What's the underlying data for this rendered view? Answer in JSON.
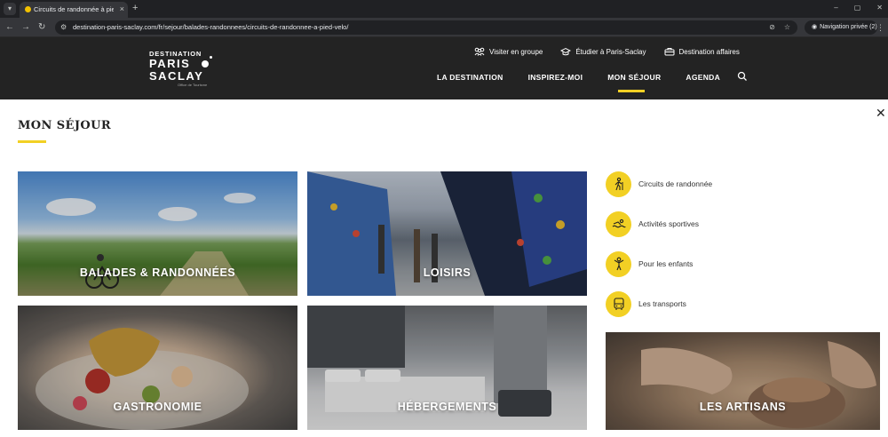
{
  "browser": {
    "tab_title": "Circuits de randonnée à pied et",
    "tab_close": "×",
    "new_tab": "+",
    "url": "destination-paris-saclay.com/fr/sejour/balades-randonnees/circuits-de-randonnee-a-pied-velo/",
    "private_label": "Navigation privée (2)",
    "window_controls": [
      "–",
      "▢",
      "✕"
    ]
  },
  "header": {
    "logo": {
      "line1": "DESTINATION",
      "line2": "PARIS",
      "line3": "SACLAY",
      "tagline": "Office de Tourisme"
    },
    "util_links": [
      {
        "label": "Visiter en groupe",
        "icon": "group-icon"
      },
      {
        "label": "Étudier à Paris-Saclay",
        "icon": "graduation-cap-icon"
      },
      {
        "label": "Destination affaires",
        "icon": "briefcase-icon"
      }
    ],
    "nav": [
      {
        "label": "LA DESTINATION",
        "active": false
      },
      {
        "label": "INSPIREZ-MOI",
        "active": false
      },
      {
        "label": "MON SÉJOUR",
        "active": true
      },
      {
        "label": "AGENDA",
        "active": false
      }
    ]
  },
  "content": {
    "close": "✕",
    "title": "MON SÉJOUR",
    "cards": [
      {
        "label": "BALADES & RANDONNÉES"
      },
      {
        "label": "LOISIRS"
      },
      {
        "label": "GASTRONOMIE"
      },
      {
        "label": "HÉBERGEMENTS"
      },
      {
        "label": "LES ARTISANS"
      }
    ],
    "links": [
      {
        "label": "Circuits de randonnée",
        "icon": "hiker-icon"
      },
      {
        "label": "Activités sportives",
        "icon": "swimmer-icon"
      },
      {
        "label": "Pour les enfants",
        "icon": "child-icon"
      },
      {
        "label": "Les transports",
        "icon": "bus-icon"
      }
    ]
  },
  "colors": {
    "accent": "#f2d024",
    "header_bg": "#232323"
  }
}
